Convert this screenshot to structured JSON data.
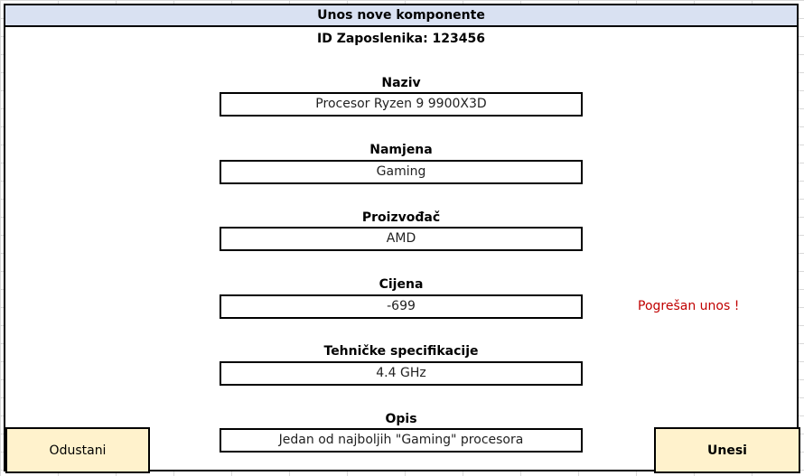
{
  "form": {
    "title": "Unos nove komponente",
    "employee_id": "ID Zaposlenika: 123456",
    "fields": [
      {
        "label": "Naziv",
        "value": "Procesor Ryzen 9 9900X3D"
      },
      {
        "label": "Namjena",
        "value": "Gaming"
      },
      {
        "label": "Proizvođač",
        "value": "AMD"
      },
      {
        "label": "Cijena",
        "value": "-699"
      },
      {
        "label": "Tehničke specifikacije",
        "value": "4.4 GHz"
      },
      {
        "label": "Opis",
        "value": "Jedan od najboljih \"Gaming\" procesora"
      }
    ],
    "error_message": "Pogrešan unos !",
    "buttons": {
      "cancel": "Odustani",
      "submit": "Unesi"
    }
  },
  "colors": {
    "title_background": "#d9e1f2",
    "button_background": "#fff2cc",
    "error_text": "#c00000"
  }
}
